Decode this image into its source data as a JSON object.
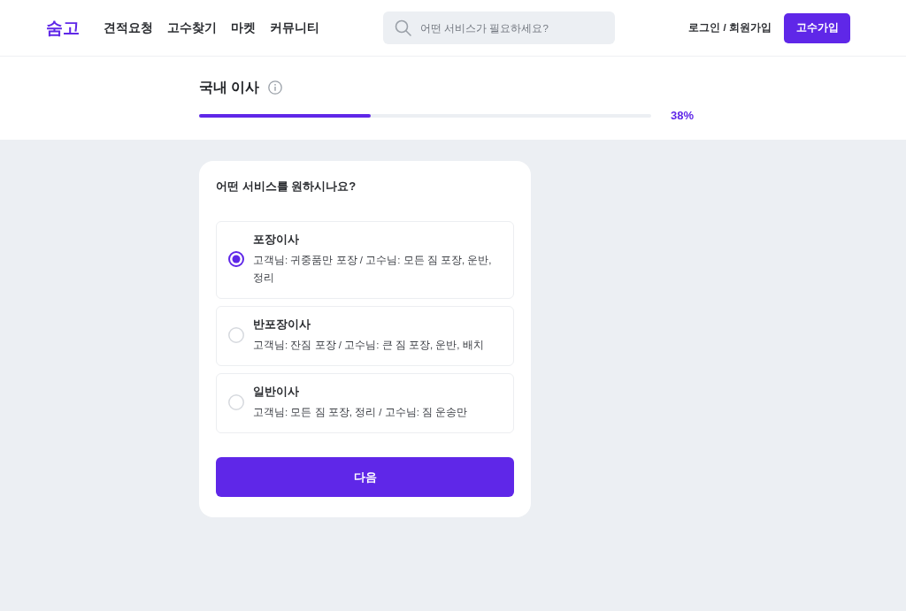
{
  "header": {
    "logo": "숨고",
    "nav": [
      "견적요청",
      "고수찾기",
      "마켓",
      "커뮤니티"
    ],
    "search": {
      "placeholder": "어떤 서비스가 필요하세요?"
    },
    "login_link": "로그인 / 회원가입",
    "signup_button": "고수가입"
  },
  "progress": {
    "title": "국내 이사",
    "level": 0.38,
    "reading": "38%"
  },
  "form": {
    "question": "어떤 서비스를 원하시나요?",
    "options": [
      {
        "title": "포장이사",
        "description": "고객님: 귀중품만 포장 / 고수님: 모든 짐 포장, 운반, 정리",
        "selected": true
      },
      {
        "title": "반포장이사",
        "description": "고객님: 잔짐 포장 / 고수님: 큰 짐 포장, 운반, 배치",
        "selected": false
      },
      {
        "title": "일반이사",
        "description": "고객님: 모든 짐 포장, 정리 / 고수님: 짐 운송만",
        "selected": false
      }
    ],
    "next_button": "다음"
  }
}
